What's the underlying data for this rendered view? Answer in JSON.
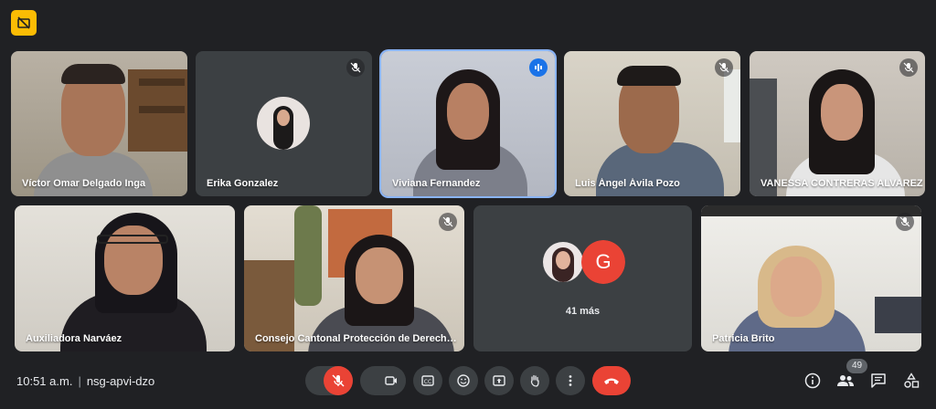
{
  "meeting": {
    "time": "10:51 a.m.",
    "code": "nsg-apvi-dzo"
  },
  "participants": [
    {
      "name": "Víctor Omar Delgado Inga"
    },
    {
      "name": "Erika Gonzalez"
    },
    {
      "name": "Viviana Fernandez"
    },
    {
      "name": "Luis Ángel Ávila Pozo"
    },
    {
      "name": "VANESSA CONTRERAS ALVAREZ"
    },
    {
      "name": "Auxiliadora Narváez"
    },
    {
      "name": "Consejo Cantonal Protección de Derecho…"
    },
    {
      "name": "Patricia Brito"
    }
  ],
  "overflow": {
    "label": "41 más",
    "avatar_letter": "G",
    "avatar_color": "#ea4335"
  },
  "people_count": "49",
  "colors": {
    "background": "#202124",
    "tile": "#3c4043",
    "accent": "#8ab4f8",
    "hangup": "#ea4335",
    "badge": "#fbbc04"
  },
  "icons": [
    "presentation-off-icon",
    "mic-off-icon",
    "camera-icon",
    "captions-icon",
    "emoji-icon",
    "present-icon",
    "raise-hand-icon",
    "more-options-icon",
    "hang-up-icon",
    "info-icon",
    "people-icon",
    "chat-icon",
    "activities-icon"
  ]
}
